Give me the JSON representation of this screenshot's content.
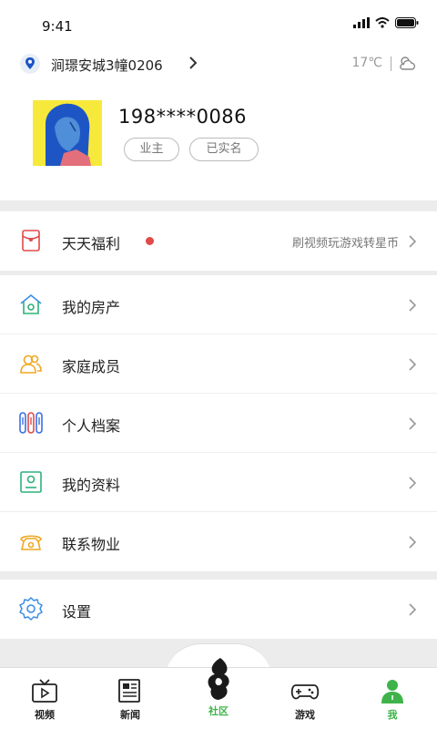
{
  "status_bar": {
    "time": "9:41"
  },
  "location": {
    "address": "涧璟安城3幢0206",
    "temperature": "17℃"
  },
  "profile": {
    "phone": "198****0086",
    "tags": [
      "业主",
      "已实名"
    ]
  },
  "welfare": {
    "label": "天天福利",
    "hint": "刷视频玩游戏转星币",
    "icon": "red-envelope-icon",
    "accent": "#e04a4a"
  },
  "menu": [
    {
      "label": "我的房产",
      "icon": "house-icon",
      "color": "#3a8ee6"
    },
    {
      "label": "家庭成员",
      "icon": "family-icon",
      "color": "#f0a820"
    },
    {
      "label": "个人档案",
      "icon": "archive-icon",
      "color": "#3a6ee6"
    },
    {
      "label": "我的资料",
      "icon": "profile-card-icon",
      "color": "#2fb07a"
    },
    {
      "label": "联系物业",
      "icon": "phone-icon",
      "color": "#f0a820"
    }
  ],
  "settings": {
    "label": "设置",
    "icon": "gear-icon"
  },
  "tabs": [
    {
      "label": "视频",
      "icon": "tv-icon"
    },
    {
      "label": "新闻",
      "icon": "news-icon"
    },
    {
      "label": "社区",
      "icon": "community-logo-icon"
    },
    {
      "label": "游戏",
      "icon": "gamepad-icon"
    },
    {
      "label": "我",
      "icon": "person-icon",
      "active": true
    }
  ],
  "colors": {
    "active_tab": "#3fb34a",
    "background": "#ececec"
  }
}
